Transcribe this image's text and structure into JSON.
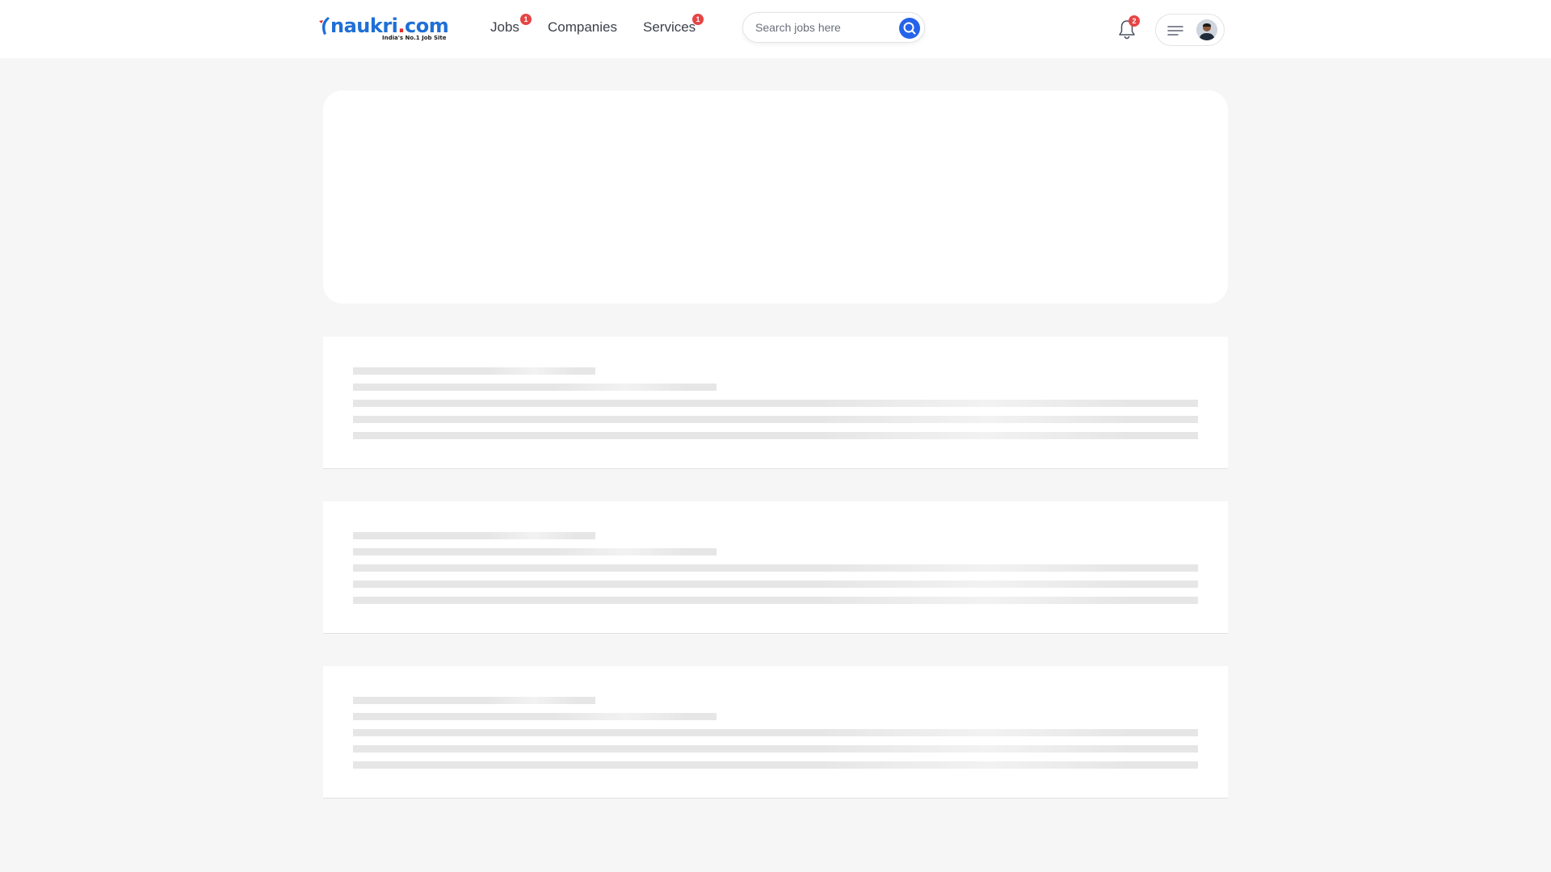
{
  "header": {
    "logo": {
      "name": "naukri.com",
      "main_text": "naukri",
      "dot_text": ".",
      "com_text": "com",
      "tagline": "India's No.1 Job Site"
    },
    "nav": [
      {
        "label": "Jobs",
        "badge": "1"
      },
      {
        "label": "Companies",
        "badge": ""
      },
      {
        "label": "Services",
        "badge": "1"
      }
    ],
    "search": {
      "placeholder": "Search jobs here",
      "value": "",
      "button_icon": "search-icon"
    },
    "notifications": {
      "icon": "bell-icon",
      "count": "2"
    },
    "profile": {
      "menu_icon": "hamburger-icon",
      "avatar_icon": "user-avatar"
    }
  },
  "main": {
    "hero_card": {
      "state": "loading"
    },
    "skeleton_cards": [
      {
        "state": "loading"
      },
      {
        "state": "loading"
      },
      {
        "state": "loading"
      }
    ]
  },
  "colors": {
    "page_background": "#f6f6f6",
    "card_background": "#ffffff",
    "brand_blue": "#1f6fd6",
    "search_button_blue": "#2563eb",
    "badge_red": "#e64545",
    "skeleton_gray": "#e6e6e6"
  }
}
